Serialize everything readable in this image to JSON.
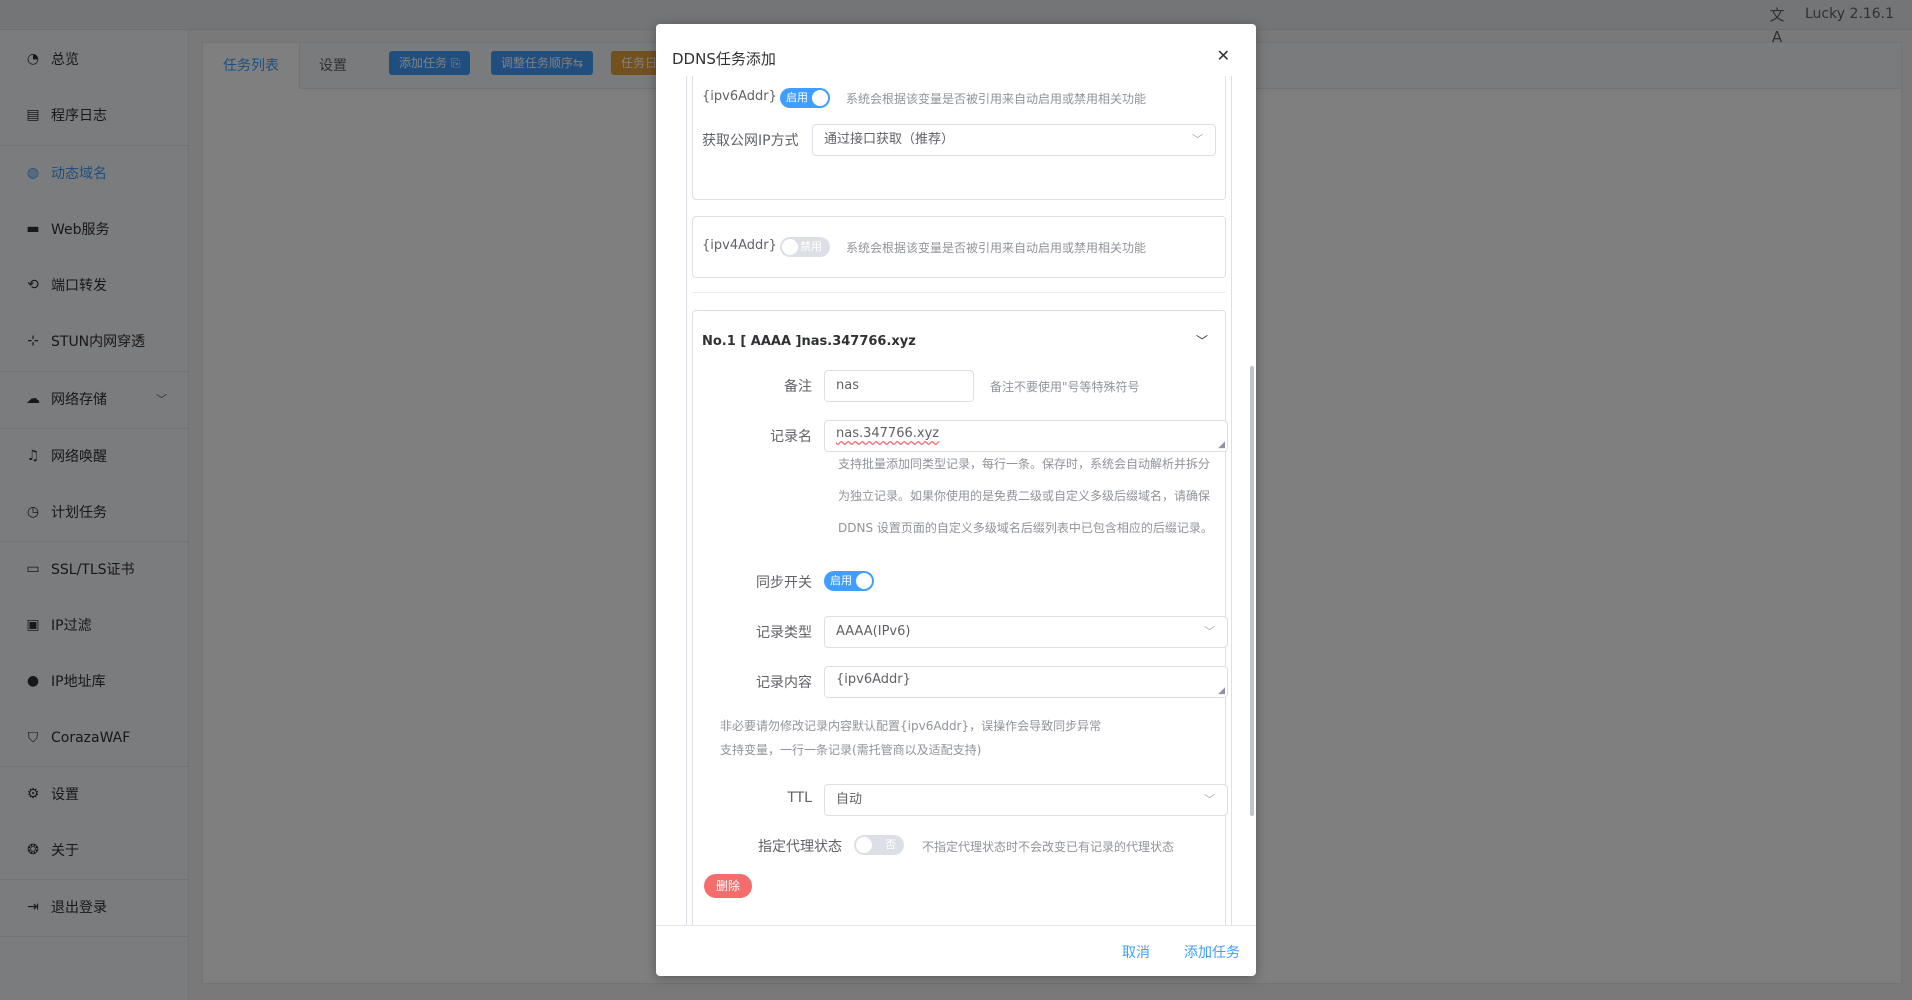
{
  "app": {
    "version": "Lucky 2.16.1",
    "lang_icon": "translate-icon"
  },
  "sidebar": {
    "items": [
      {
        "label": "总览",
        "icon": "dashboard-icon"
      },
      {
        "label": "程序日志",
        "icon": "log-icon"
      },
      {
        "label": "动态域名",
        "icon": "dns-icon",
        "active": true
      },
      {
        "label": "Web服务",
        "icon": "web-icon"
      },
      {
        "label": "端口转发",
        "icon": "port-forward-icon"
      },
      {
        "label": "STUN内网穿透",
        "icon": "stun-icon"
      },
      {
        "label": "网络存储",
        "icon": "cloud-storage-icon",
        "expandable": true
      },
      {
        "label": "网络唤醒",
        "icon": "bell-icon"
      },
      {
        "label": "计划任务",
        "icon": "clock-icon"
      },
      {
        "label": "SSL/TLS证书",
        "icon": "certificate-icon"
      },
      {
        "label": "IP过滤",
        "icon": "filter-icon"
      },
      {
        "label": "IP地址库",
        "icon": "person-icon"
      },
      {
        "label": "CorazaWAF",
        "icon": "shield-icon"
      },
      {
        "label": "设置",
        "icon": "gear-icon"
      },
      {
        "label": "关于",
        "icon": "about-icon"
      },
      {
        "label": "退出登录",
        "icon": "logout-icon"
      }
    ]
  },
  "main": {
    "tabs": [
      {
        "label": "任务列表"
      },
      {
        "label": "设置"
      }
    ],
    "buttons": {
      "add_task": "添加任务 ⎘",
      "reorder": "调整任务顺序⇆",
      "third": "任务日"
    }
  },
  "dialog": {
    "title": "DDNS任务添加",
    "ipv6_var": {
      "label": "{ipv6Addr}",
      "switch_text": "启用",
      "hint": "系统会根据该变量是否被引用来自动启用或禁用相关功能",
      "ip_method_label": "获取公网IP方式",
      "ip_method_value": "通过接口获取（推荐）"
    },
    "ipv4_var": {
      "label": "{ipv4Addr}",
      "switch_text": "禁用",
      "hint": "系统会根据该变量是否被引用来自动启用或禁用相关功能"
    },
    "record": {
      "title": "No.1 [ AAAA ]nas.347766.xyz",
      "remark_label": "备注",
      "remark_value": "nas",
      "remark_hint": "备注不要使用\"号等特殊符号",
      "name_label": "记录名",
      "name_value": "nas.347766.xyz",
      "name_hint_1": "支持批量添加同类型记录，每行一条。保存时，系统会自动解析并拆分",
      "name_hint_2": "为独立记录。如果你使用的是免费二级或自定义多级后缀域名，请确保",
      "name_hint_3": "DDNS 设置页面的自定义多级域名后缀列表中已包含相应的后缀记录。",
      "sync_label": "同步开关",
      "sync_text": "启用",
      "type_label": "记录类型",
      "type_value": "AAAA(IPv6)",
      "content_label": "记录内容",
      "content_value": "{ipv6Addr}",
      "content_hint_1": "非必要请勿修改记录内容默认配置{ipv6Addr}，误操作会导致同步异常",
      "content_hint_2": "支持变量，一行一条记录(需托管商以及适配支持)",
      "ttl_label": "TTL",
      "ttl_value": "自动",
      "proxy_label": "指定代理状态",
      "proxy_text": "否",
      "proxy_hint": "不指定代理状态时不会改变已有记录的代理状态",
      "delete_label": "删除"
    },
    "footer": {
      "cancel": "取消",
      "confirm": "添加任务"
    }
  }
}
